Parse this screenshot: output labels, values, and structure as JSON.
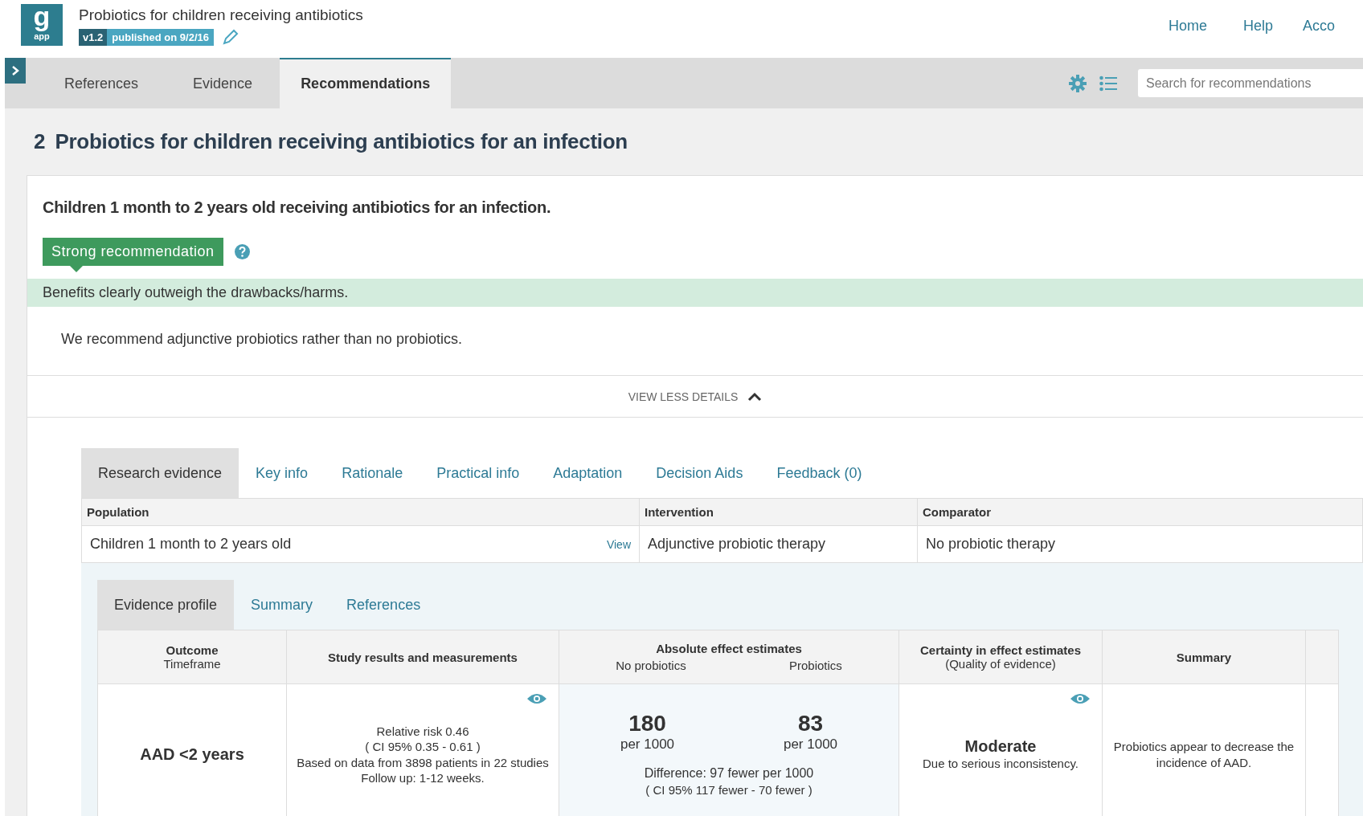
{
  "header": {
    "logo_letter": "g",
    "logo_sub": "app",
    "title": "Probiotics for children receiving antibiotics",
    "version": "v1.2",
    "published": "published on 9/2/16",
    "links": [
      "Home",
      "Help",
      "Acco"
    ]
  },
  "nav": {
    "tabs": [
      {
        "label": "References",
        "selected": false
      },
      {
        "label": "Evidence",
        "selected": false
      },
      {
        "label": "Recommendations",
        "selected": true
      }
    ],
    "search": {
      "placeholder": "Search for recommendations"
    }
  },
  "recommendation": {
    "number": "2",
    "title": "Probiotics for children receiving antibiotics for an infection",
    "question": "Children 1 month to 2 years old receiving antibiotics for an infection.",
    "strength": "Strong recommendation",
    "band": "Benefits clearly outweigh the drawbacks/harms.",
    "text": "We recommend adjunctive probiotics rather than no probiotics.",
    "toggle": "VIEW LESS DETAILS",
    "expanded": true
  },
  "detail_tabs": [
    {
      "label": "Research evidence",
      "selected": true
    },
    {
      "label": "Key info",
      "selected": false
    },
    {
      "label": "Rationale",
      "selected": false
    },
    {
      "label": "Practical info",
      "selected": false
    },
    {
      "label": "Adaptation",
      "selected": false
    },
    {
      "label": "Decision Aids",
      "selected": false
    },
    {
      "label": "Feedback (0)",
      "selected": false
    }
  ],
  "pico": {
    "columns": [
      "Population",
      "Intervention",
      "Comparator"
    ],
    "population": "Children 1 month to 2 years old",
    "view_link": "View",
    "intervention": "Adjunctive probiotic therapy",
    "comparator": "No probiotic therapy"
  },
  "sub_tabs": [
    {
      "label": "Evidence profile",
      "selected": true
    },
    {
      "label": "Summary",
      "selected": false
    },
    {
      "label": "References",
      "selected": false
    }
  ],
  "profile": {
    "headers": {
      "outcome": "Outcome",
      "timeframe": "Timeframe",
      "study": "Study results and measurements",
      "absolute": "Absolute effect estimates",
      "no_probiotics": "No probiotics",
      "probiotics": "Probiotics",
      "certainty": "Certainty in effect estimates",
      "quality": "(Quality of evidence)",
      "summary": "Summary"
    },
    "rows": [
      {
        "outcome": "AAD <2 years",
        "study_lines": [
          "Relative risk 0.46",
          "( CI 95% 0.35 - 0.61 )",
          "Based on data from 3898 patients in 22 studies",
          "Follow up: 1-12 weeks."
        ],
        "control": "180",
        "control_unit": "per 1000",
        "treatment": "83",
        "treatment_unit": "per 1000",
        "difference": "Difference: 97 fewer per 1000",
        "difference_ci": "( CI 95% 117 fewer - 70 fewer )",
        "certainty": "Moderate",
        "certainty_reason": "Due to serious inconsistency.",
        "summary": "Probiotics appear to decrease the incidence of AAD."
      }
    ]
  }
}
